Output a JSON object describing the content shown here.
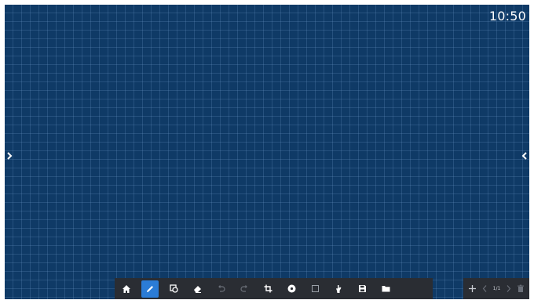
{
  "clock": {
    "time": "10:50"
  },
  "toolbar": {
    "tools": [
      {
        "name": "home-icon",
        "active": false
      },
      {
        "name": "pen-icon",
        "active": true
      },
      {
        "name": "shape-recognition-icon",
        "active": false
      },
      {
        "name": "eraser-icon",
        "active": false
      },
      {
        "name": "undo-icon",
        "active": false,
        "disabled": true
      },
      {
        "name": "redo-icon",
        "active": false,
        "disabled": true
      },
      {
        "name": "crop-icon",
        "active": false
      },
      {
        "name": "background-icon",
        "active": false
      },
      {
        "name": "select-icon",
        "active": false
      },
      {
        "name": "hand-icon",
        "active": false
      },
      {
        "name": "save-icon",
        "active": false
      },
      {
        "name": "folder-icon",
        "active": false
      }
    ]
  },
  "pagebar": {
    "page_indicator": "1/1"
  },
  "colors": {
    "board_background": "#0f3a66",
    "toolbar_background": "#2a2d33",
    "active_tool": "#2b7cd6"
  }
}
